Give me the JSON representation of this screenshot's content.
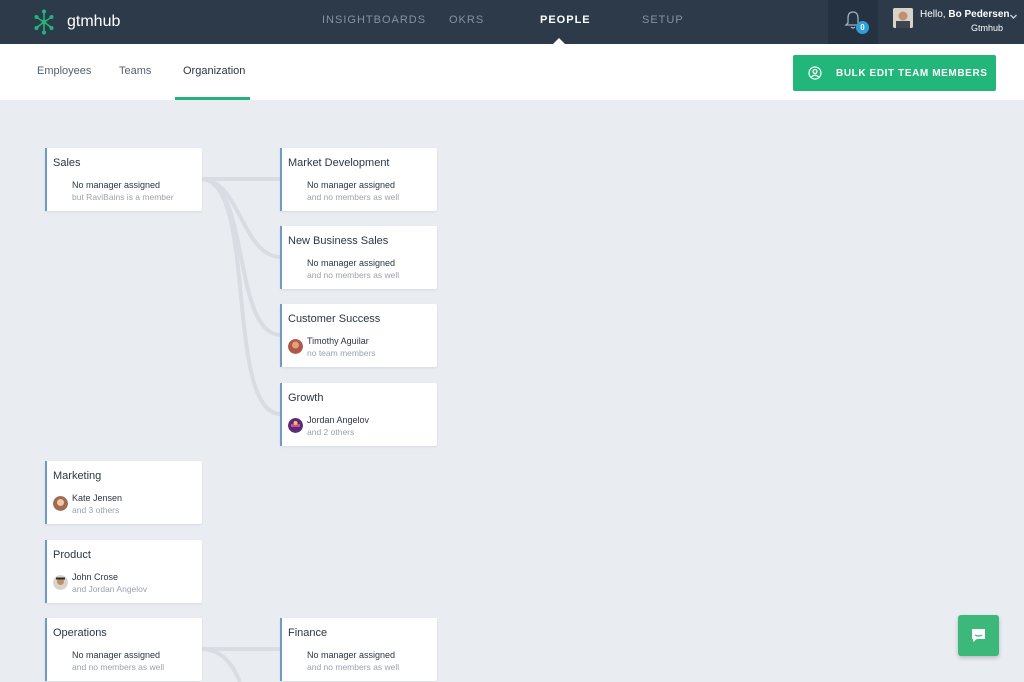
{
  "app": {
    "name": "gtmhub"
  },
  "nav": {
    "items": [
      {
        "label": "INSIGHTBOARDS",
        "active": false
      },
      {
        "label": "OKRS",
        "active": false
      },
      {
        "label": "PEOPLE",
        "active": true
      },
      {
        "label": "SETUP",
        "active": false
      }
    ]
  },
  "notifications": {
    "count": "0",
    "icon": "bell-icon"
  },
  "user": {
    "greeting": "Hello, ",
    "name": "Bo Pedersen",
    "org": "Gtmhub"
  },
  "subnav": {
    "tabs": [
      {
        "label": "Employees",
        "active": false
      },
      {
        "label": "Teams",
        "active": false
      },
      {
        "label": "Organization",
        "active": true
      }
    ],
    "bulk_edit_label": "BULK EDIT TEAM MEMBERS"
  },
  "teams": [
    {
      "name": "Sales",
      "line1": "No manager assigned",
      "line2": "but RaviBains is a member",
      "avatar": false
    },
    {
      "name": "Market Development",
      "line1": "No manager assigned",
      "line2": "and no members as well",
      "avatar": false
    },
    {
      "name": "New Business Sales",
      "line1": "No manager assigned",
      "line2": "and no members as well",
      "avatar": false
    },
    {
      "name": "Customer Success",
      "line1": "Timothy Aguilar",
      "line2": "no team members",
      "avatar": true
    },
    {
      "name": "Growth",
      "line1": "Jordan Angelov",
      "line2": "and 2 others",
      "avatar": true
    },
    {
      "name": "Marketing",
      "line1": "Kate Jensen",
      "line2": "and 3 others",
      "avatar": true
    },
    {
      "name": "Product",
      "line1": "John Crose",
      "line2": "and Jordan Angelov",
      "avatar": true
    },
    {
      "name": "Operations",
      "line1": "No manager assigned",
      "line2": "and no members as well",
      "avatar": false
    },
    {
      "name": "Finance",
      "line1": "No manager assigned",
      "line2": "and no members as well",
      "avatar": false
    }
  ],
  "colors": {
    "accent": "#22b67a",
    "nav_bg": "#2c3a4a",
    "card_border": "#6f9cc6"
  }
}
